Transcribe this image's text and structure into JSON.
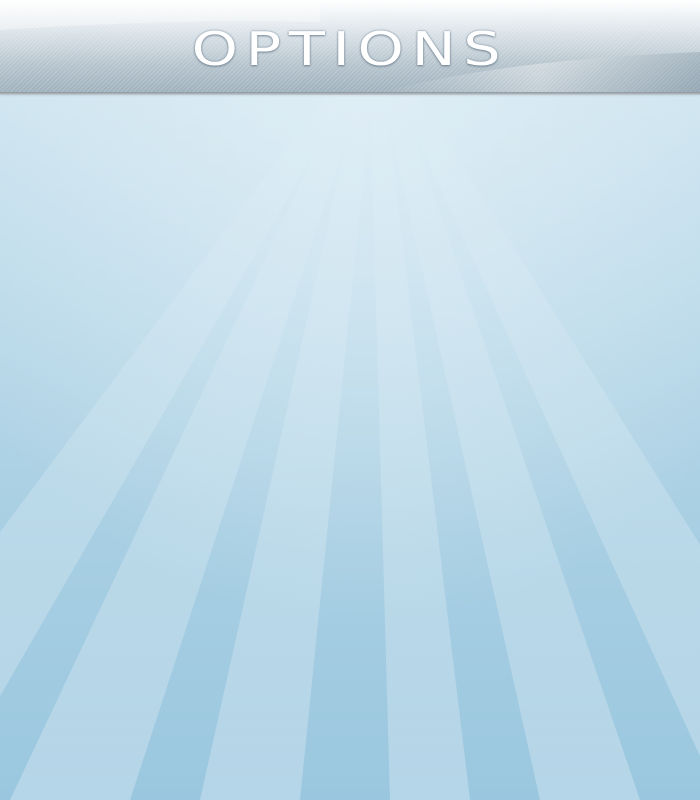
{
  "screen": {
    "title": "OPTIONS"
  },
  "colors": {
    "header_light": "#ffffff",
    "header_dark": "#9fb1bd",
    "background_top": "#d3e7f1",
    "background_bottom": "#9ac7df",
    "ray_color": "#e8f3f9",
    "title_color": "#ffffff"
  }
}
